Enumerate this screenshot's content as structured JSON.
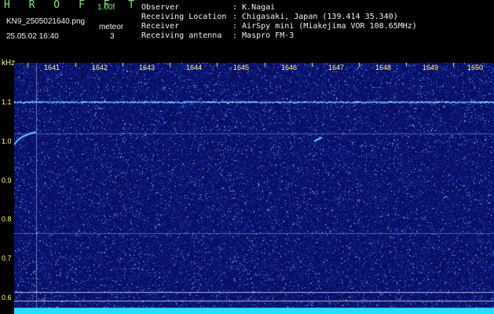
{
  "header": {
    "brand": "H R O F F T",
    "version": "1.00f",
    "filename": "KN9_2505021640.png",
    "mode": "meteor",
    "datetime": "25.05.02 16:40",
    "count": "3"
  },
  "station": {
    "rows": [
      {
        "label": "Observer",
        "value": ": K.Nagai"
      },
      {
        "label": "Receiving Location",
        "value": ": Chigasaki, Japan (139.414 35.340)"
      },
      {
        "label": "Receiver",
        "value": ": AirSpy mini (Miakejima VOR 108.65MHz)"
      },
      {
        "label": "Receiving antenna",
        "value": ": Maspro FM-3"
      }
    ]
  },
  "spectrogram": {
    "y_unit": "kHz",
    "y_ticks": [
      "1.1",
      "1.0",
      "0.9",
      "0.8",
      "0.7",
      "0.6"
    ],
    "x_ticks": [
      "1641",
      "1642",
      "1643",
      "1644",
      "1645",
      "1646",
      "1647",
      "1648",
      "1649",
      "1650"
    ],
    "colors": {
      "background": "#0a1260",
      "carrier": "#4aa8ff",
      "baseline": "#20e0ff",
      "label": "#ffff66"
    }
  }
}
